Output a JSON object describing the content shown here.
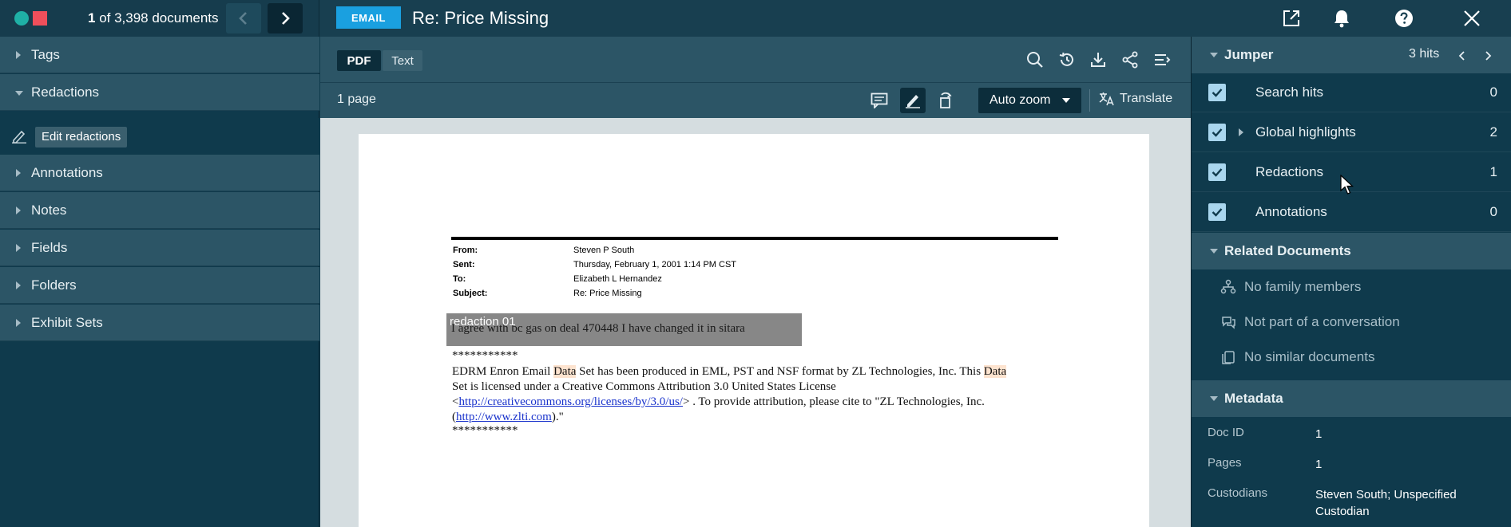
{
  "topbar": {
    "doc_index": "1",
    "doc_count_text": " of 3,398 documents",
    "doc_type_badge": "EMAIL",
    "doc_title": "Re: Price Missing"
  },
  "sidebar": {
    "items": [
      {
        "label": "Tags"
      },
      {
        "label": "Redactions"
      },
      {
        "label": "Annotations"
      },
      {
        "label": "Notes"
      },
      {
        "label": "Fields"
      },
      {
        "label": "Folders"
      },
      {
        "label": "Exhibit Sets"
      }
    ],
    "edit_redactions_label": "Edit redactions"
  },
  "toolbar": {
    "view_tabs": [
      "PDF",
      "Text"
    ],
    "page_count": "1 page",
    "zoom_value": "Auto zoom",
    "translate_label": "Translate"
  },
  "document": {
    "headers": [
      {
        "key": "From:",
        "value": "Steven P South"
      },
      {
        "key": "Sent:",
        "value": "Thursday, February 1, 2001 1:14 PM CST"
      },
      {
        "key": "To:",
        "value": "Elizabeth L Hernandez"
      },
      {
        "key": "Subject:",
        "value": "Re: Price Missing"
      }
    ],
    "redaction_label": "redaction 01",
    "redacted_text": "I agree with bc gas  on deal 470448 I have changed  it in sitara",
    "stars": "***********",
    "line1_a": "EDRM Enron Email ",
    "hl_word": "Data",
    "line1_b": " Set has been produced in EML, PST and NSF format by ZL Technologies, Inc. This ",
    "line2": "Set is licensed under a Creative Commons Attribution 3.0 United States License",
    "line3_a": "<",
    "line3_link": "http://creativecommons.org/licenses/by/3.0/us/",
    "line3_b": "> . To provide attribution, please cite to \"ZL Technologies, Inc.",
    "line4_a": "(",
    "line4_link": "http://www.zlti.com",
    "line4_b": ").\"",
    "stars_end": "***********"
  },
  "jumper": {
    "title": "Jumper",
    "hits": "3 hits",
    "rows": [
      {
        "label": "Search hits",
        "count": "0"
      },
      {
        "label": "Global highlights",
        "count": "2"
      },
      {
        "label": "Redactions",
        "count": "1"
      },
      {
        "label": "Annotations",
        "count": "0"
      }
    ]
  },
  "related": {
    "title": "Related Documents",
    "rows": [
      {
        "label": "No family members",
        "icon": "family-tree-icon"
      },
      {
        "label": "Not part of a conversation",
        "icon": "conversation-icon"
      },
      {
        "label": "No similar documents",
        "icon": "similar-docs-icon"
      }
    ]
  },
  "metadata": {
    "title": "Metadata",
    "rows": [
      {
        "key": "Doc ID",
        "value": "1"
      },
      {
        "key": "Pages",
        "value": "1"
      },
      {
        "key": "Custodians",
        "value": "Steven South; Unspecified Custodian"
      }
    ]
  },
  "colors": {
    "accent": "#1aa0e0",
    "teal": "#1fb0a6",
    "red": "#ef4f5b",
    "panel": "#2c5566",
    "background": "#0f3a4c"
  }
}
